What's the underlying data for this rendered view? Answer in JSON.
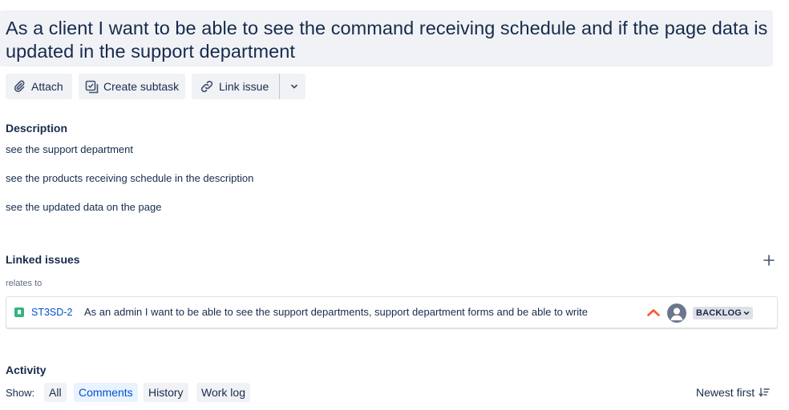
{
  "issue": {
    "title": "As a client I want to be able to see the command receiving schedule and if the page data is updated in the support department"
  },
  "toolbar": {
    "attach_label": "Attach",
    "create_subtask_label": "Create subtask",
    "link_issue_label": "Link issue"
  },
  "description": {
    "heading": "Description",
    "paragraphs": [
      "see the support department",
      "see the products receiving schedule in the description",
      "see the updated data on the page"
    ]
  },
  "linked_issues": {
    "heading": "Linked issues",
    "relation": "relates to",
    "items": [
      {
        "key": "ST3SD-2",
        "summary": "As an admin I want to be able to see the support departments, support department forms and be able to write",
        "status": "BACKLOG",
        "priority_icon": "priority-high-icon",
        "type_icon": "story-icon",
        "status_color": "#dfe1e6"
      }
    ]
  },
  "activity": {
    "heading": "Activity",
    "show_label": "Show:",
    "filters": [
      "All",
      "Comments",
      "History",
      "Work log"
    ],
    "active_filter": "Comments",
    "sort_label": "Newest first"
  },
  "colors": {
    "text": "#172b4d",
    "link": "#0052cc",
    "story": "#36b37e",
    "priority": "#ff5630",
    "button_bg": "#f0f2f5",
    "active_bg": "#e9f2ff"
  }
}
